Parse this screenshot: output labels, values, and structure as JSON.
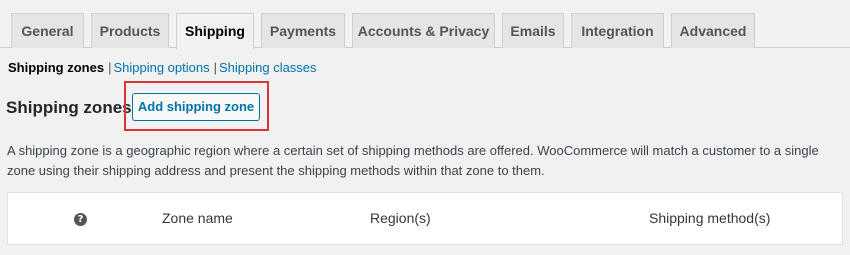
{
  "tabs": [
    {
      "label": "General"
    },
    {
      "label": "Products"
    },
    {
      "label": "Shipping",
      "active": true
    },
    {
      "label": "Payments"
    },
    {
      "label": "Accounts & Privacy"
    },
    {
      "label": "Emails"
    },
    {
      "label": "Integration"
    },
    {
      "label": "Advanced"
    }
  ],
  "subnav": {
    "current": "Shipping zones",
    "separator": "|",
    "items": [
      "Shipping options",
      "Shipping classes"
    ]
  },
  "section": {
    "title": "Shipping zones",
    "add_button": "Add shipping zone",
    "description": "A shipping zone is a geographic region where a certain set of shipping methods are offered. WooCommerce will match a customer to a single zone using their shipping address and present the shipping methods within that zone to them."
  },
  "table": {
    "help_icon": "?",
    "columns": [
      "Zone name",
      "Region(s)",
      "Shipping method(s)"
    ]
  },
  "colors": {
    "link": "#0073aa",
    "highlight": "#d63638",
    "background": "#f1f1f1"
  }
}
